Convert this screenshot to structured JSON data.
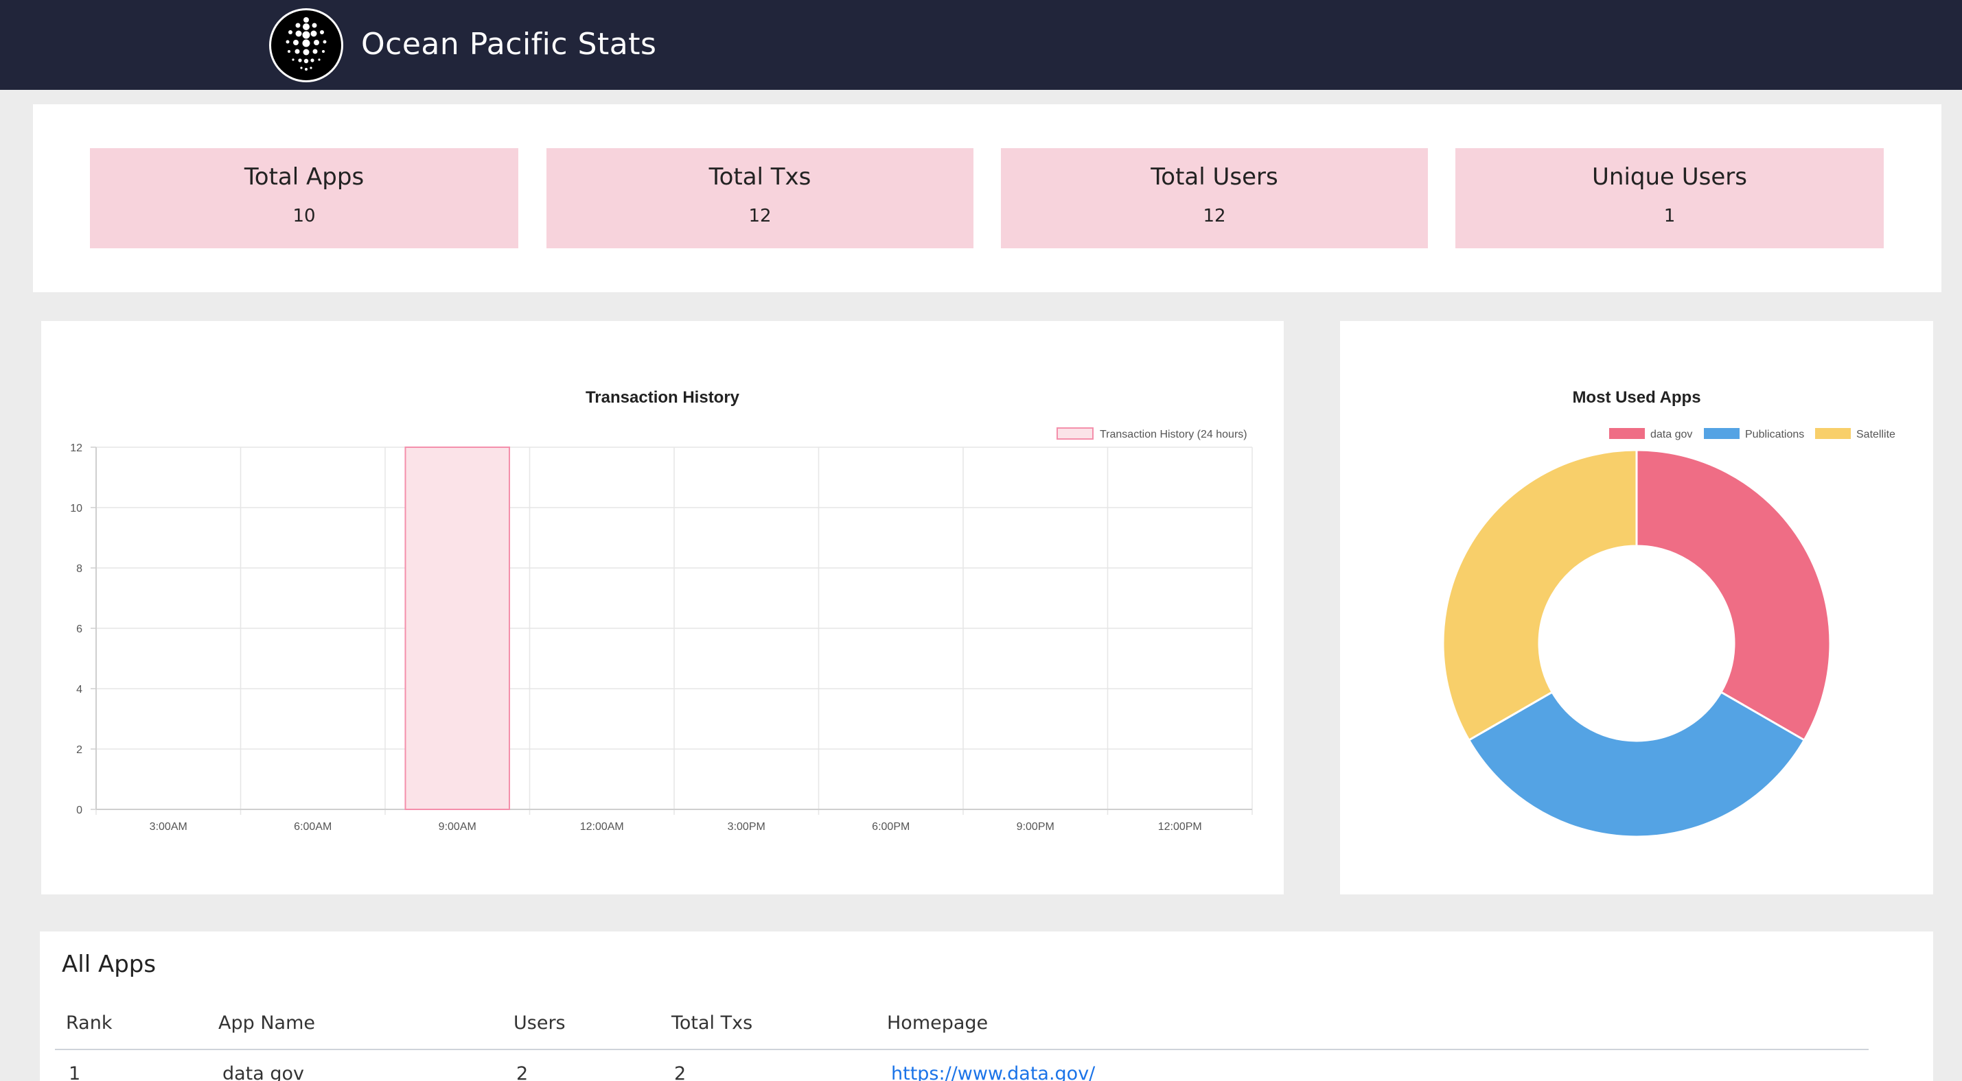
{
  "header": {
    "title": "Ocean Pacific Stats"
  },
  "stats": [
    {
      "label": "Total Apps",
      "value": "10"
    },
    {
      "label": "Total Txs",
      "value": "12"
    },
    {
      "label": "Total Users",
      "value": "12"
    },
    {
      "label": "Unique Users",
      "value": "1"
    }
  ],
  "chart_data": [
    {
      "type": "bar",
      "title": "Transaction History",
      "categories": [
        "3:00AM",
        "6:00AM",
        "9:00AM",
        "12:00AM",
        "3:00PM",
        "6:00PM",
        "9:00PM",
        "12:00PM"
      ],
      "series": [
        {
          "name": "Transaction History (24 hours)",
          "values": [
            0,
            0,
            12,
            0,
            0,
            0,
            0,
            0
          ]
        }
      ],
      "ylim": [
        0,
        12
      ],
      "yticks": [
        0,
        2,
        4,
        6,
        8,
        10,
        12
      ],
      "grid": true,
      "legend": "top-right",
      "colors": {
        "fill": "#fbe3e8",
        "stroke": "#f48fab"
      }
    },
    {
      "type": "pie",
      "title": "Most Used Apps",
      "donut": true,
      "labels": [
        "data gov",
        "Publications",
        "Satellite"
      ],
      "values": [
        1,
        1,
        1
      ],
      "colors": [
        "#ef6d85",
        "#54a3e4",
        "#f8cf6a"
      ],
      "legend": "top-right"
    }
  ],
  "apps": {
    "title": "All Apps",
    "columns": [
      "Rank",
      "App Name",
      "Users",
      "Total Txs",
      "Homepage"
    ],
    "rows": [
      [
        "1",
        "data gov",
        "2",
        "2",
        "https://www.data.gov/"
      ]
    ]
  }
}
